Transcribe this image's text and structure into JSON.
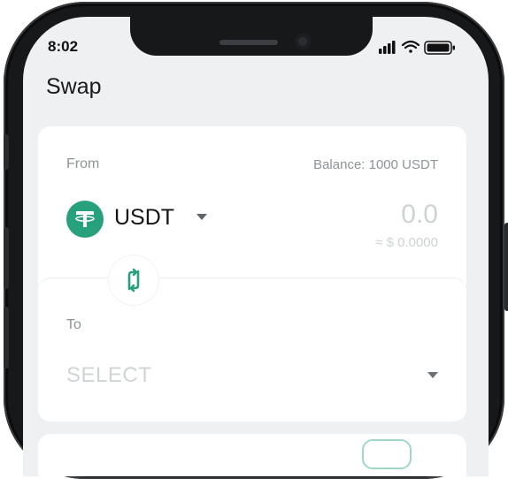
{
  "status_bar": {
    "time": "8:02"
  },
  "header": {
    "title": "Swap"
  },
  "from_card": {
    "label": "From",
    "balance": "Balance: 1000 USDT",
    "token": {
      "symbol": "USDT",
      "icon": "tether-icon"
    },
    "amount": "0.0",
    "usd_value": "≈ $ 0.0000"
  },
  "swap": {
    "icon": "swap-arrows-icon"
  },
  "to_card": {
    "label": "To",
    "select_value": "SELECT"
  },
  "colors": {
    "accent": "#26a17b",
    "screen_bg": "#eff0f1",
    "muted_text": "#8e9396",
    "placeholder_text": "#cfd2d3"
  }
}
